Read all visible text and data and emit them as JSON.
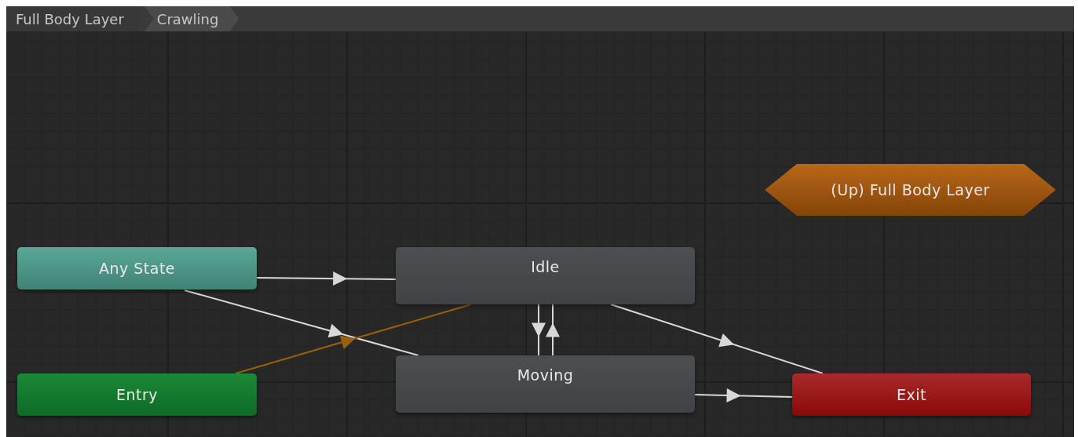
{
  "breadcrumbs": [
    {
      "label": "Full Body Layer",
      "selected": false
    },
    {
      "label": "Crawling",
      "selected": true
    }
  ],
  "nodes": [
    {
      "label": "Any State",
      "kind": "any"
    },
    {
      "label": "Entry",
      "kind": "entry"
    },
    {
      "label": "Idle",
      "kind": "state"
    },
    {
      "label": "Moving",
      "kind": "state"
    },
    {
      "label": "Exit",
      "kind": "exit"
    },
    {
      "label": "(Up) Full Body Layer",
      "kind": "parent"
    }
  ],
  "transitions": [
    {
      "kind": "normal"
    },
    {
      "kind": "normal"
    },
    {
      "kind": "default"
    },
    {
      "kind": "normal"
    },
    {
      "kind": "normal"
    },
    {
      "kind": "normal"
    },
    {
      "kind": "normal"
    }
  ]
}
